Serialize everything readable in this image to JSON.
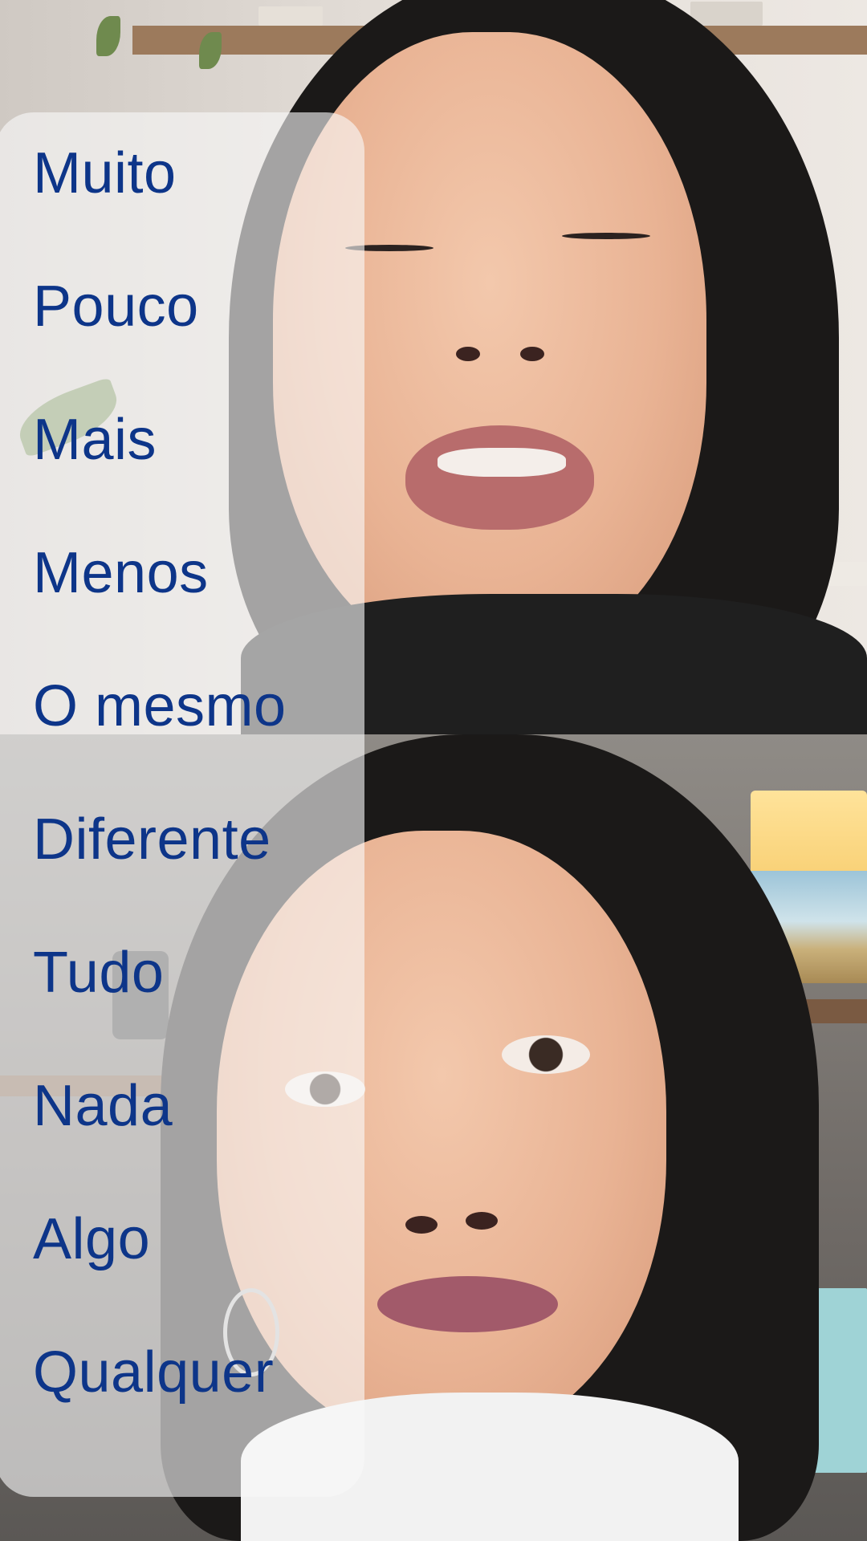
{
  "screen": {
    "type": "split-screen video call",
    "top_participant": "video-tile",
    "bottom_participant": "video-tile"
  },
  "colors": {
    "word_text": "#0d3589",
    "panel_background": "rgba(248,248,248,0.62)"
  },
  "word_list": {
    "items": [
      "Muito",
      "Pouco",
      "Mais",
      "Menos",
      "O mesmo",
      "Diferente",
      "Tudo",
      "Nada",
      "Algo",
      "Qualquer"
    ]
  }
}
